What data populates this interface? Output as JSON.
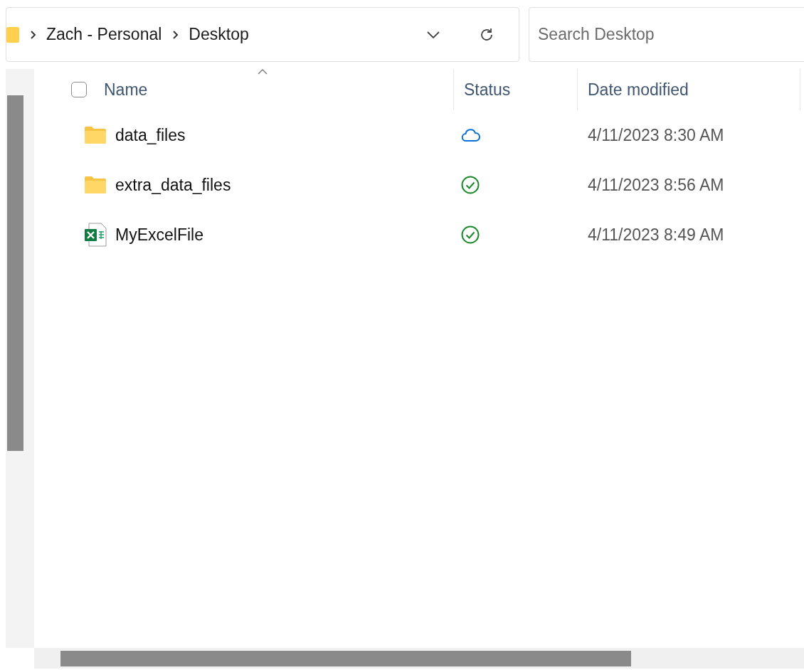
{
  "address_bar": {
    "breadcrumbs": [
      "Zach - Personal",
      "Desktop"
    ]
  },
  "search": {
    "placeholder": "Search Desktop"
  },
  "header": {
    "select_all_checked": false,
    "columns": [
      "Name",
      "Status",
      "Date modified"
    ]
  },
  "files": [
    {
      "kind": "folder",
      "name": "data_files",
      "synced": false,
      "date": "4/11/2023 8:30 AM"
    },
    {
      "kind": "folder",
      "name": "extra_data_files",
      "synced": true,
      "date": "4/11/2023 8:56 AM"
    },
    {
      "kind": "excel",
      "name": "MyExcelFile",
      "synced": true,
      "date": "4/11/2023 8:49 AM"
    }
  ]
}
